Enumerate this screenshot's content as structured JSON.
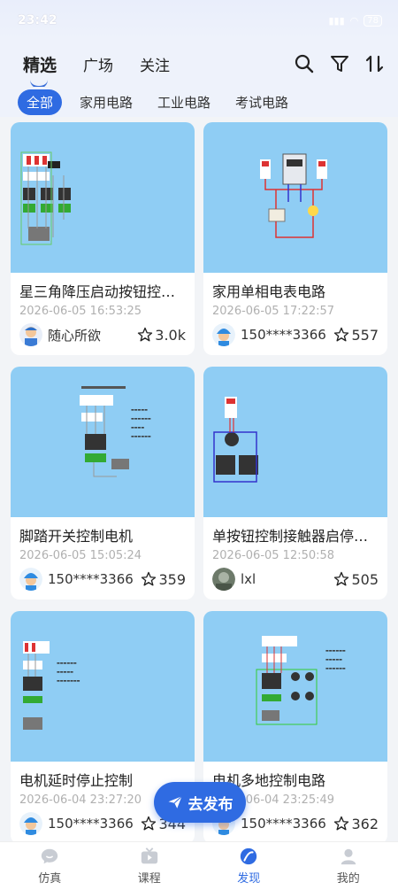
{
  "status": {
    "time": "23:42",
    "battery": "78"
  },
  "header": {
    "tabs": [
      {
        "label": "精选",
        "active": true
      },
      {
        "label": "广场",
        "active": false
      },
      {
        "label": "关注",
        "active": false
      }
    ],
    "icons": [
      "search-icon",
      "filter-icon",
      "sort-icon"
    ]
  },
  "chips": [
    {
      "label": "全部",
      "active": true
    },
    {
      "label": "家用电路",
      "active": false
    },
    {
      "label": "工业电路",
      "active": false
    },
    {
      "label": "考试电路",
      "active": false
    }
  ],
  "cards": [
    {
      "title": "星三角降压启动按钮控制电路",
      "date": "2026-06-05 16:53:25",
      "user": "随心所欲",
      "stars": "3.0k",
      "avatar": "cartoon"
    },
    {
      "title": "家用单相电表电路",
      "date": "2026-06-05 17:22:57",
      "user": "150****3366",
      "stars": "557",
      "avatar": "worker"
    },
    {
      "title": "脚踏开关控制电机",
      "date": "2026-06-05 15:05:24",
      "user": "150****3366",
      "stars": "359",
      "avatar": "worker"
    },
    {
      "title": "单按钮控制接触器启停电路",
      "date": "2026-06-05 12:50:58",
      "user": "lxl",
      "stars": "505",
      "avatar": "photo"
    },
    {
      "title": "电机延时停止控制",
      "date": "2026-06-04 23:27:20",
      "user": "150****3366",
      "stars": "344",
      "avatar": "worker"
    },
    {
      "title": "电机多地控制电路",
      "date": "2026-06-04 23:25:49",
      "user": "150****3366",
      "stars": "362",
      "avatar": "worker"
    }
  ],
  "fab": {
    "label": "去发布"
  },
  "bottom_nav": [
    {
      "label": "仿真",
      "active": false
    },
    {
      "label": "课程",
      "active": false
    },
    {
      "label": "发现",
      "active": true
    },
    {
      "label": "我的",
      "active": false
    }
  ],
  "colors": {
    "accent": "#2f6be2",
    "thumb_bg": "#8fcdf4"
  }
}
